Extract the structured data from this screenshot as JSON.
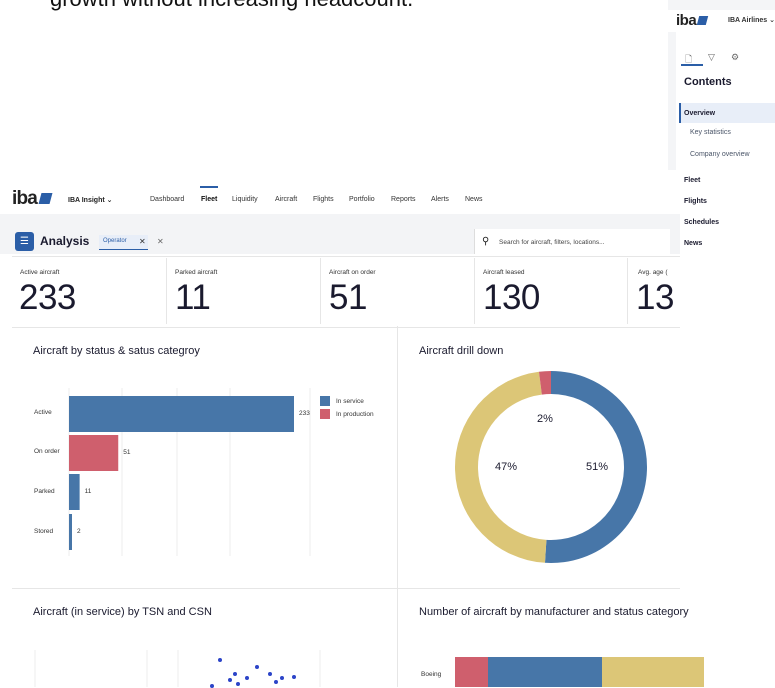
{
  "headline": "growth without increasing headcount.",
  "back_panel": {
    "logo": "iba",
    "airline_selector": "IBA Airlines ⌄",
    "contents_title": "Contents",
    "items": [
      {
        "label": "Overview",
        "style": "bold"
      },
      {
        "label": "Key statistics",
        "style": "sub"
      },
      {
        "label": "Company overview",
        "style": "sub"
      },
      {
        "label": "Fleet",
        "style": "bold"
      },
      {
        "label": "Flights",
        "style": "bold"
      },
      {
        "label": "Schedules",
        "style": "bold"
      },
      {
        "label": "News",
        "style": "bold"
      }
    ]
  },
  "app": {
    "logo": "iba",
    "product": "IBA Insight ⌄",
    "nav": [
      "Dashboard",
      "Fleet",
      "Liquidity",
      "Aircraft",
      "Flights",
      "Portfolio",
      "Reports",
      "Alerts",
      "News"
    ],
    "active_nav": "Fleet",
    "analysis_title": "Analysis",
    "filter_chip": "Operator",
    "search_placeholder": "Search for aircraft, filters, locations..."
  },
  "kpis": [
    {
      "label": "Active aircraft",
      "value": "233"
    },
    {
      "label": "Parked aircraft",
      "value": "11"
    },
    {
      "label": "Aircraft on order",
      "value": "51"
    },
    {
      "label": "Aircraft leased",
      "value": "130"
    },
    {
      "label": "Avg. age (",
      "value": "13"
    }
  ],
  "colors": {
    "accent": "#2b5ea7",
    "in_service": "#4776a8",
    "in_production": "#cf5f6d",
    "third": "#dcc677"
  },
  "chart_data": [
    {
      "type": "bar",
      "title": "Aircraft by status & satus categroy",
      "categories": [
        "Active",
        "On order",
        "Parked",
        "Stored"
      ],
      "series": [
        {
          "name": "In service",
          "values": [
            233,
            0,
            11,
            2
          ]
        },
        {
          "name": "In production",
          "values": [
            0,
            51,
            0,
            0
          ]
        }
      ],
      "xlim": [
        0,
        233
      ],
      "legend": "right"
    },
    {
      "type": "pie",
      "title": "Aircraft drill down",
      "slices": [
        {
          "label": "51%",
          "value": 51
        },
        {
          "label": "47%",
          "value": 47
        },
        {
          "label": "2%",
          "value": 2
        }
      ]
    },
    {
      "type": "scatter",
      "title": "Aircraft (in service) by TSN and CSN"
    },
    {
      "type": "bar",
      "title": "Number of aircraft by manufacturer and status category",
      "categories": [
        "Boeing"
      ]
    }
  ]
}
